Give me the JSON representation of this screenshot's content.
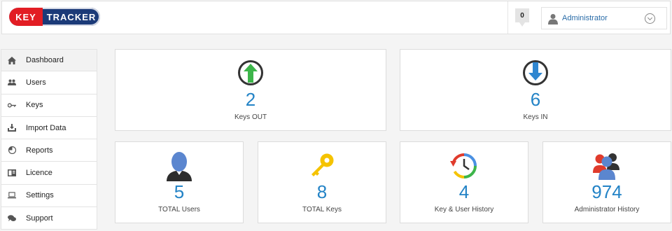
{
  "header": {
    "logo_left": "KEY",
    "logo_right": "TRACKER",
    "notification_count": "0",
    "user_name": "Administrator"
  },
  "sidebar": {
    "items": [
      {
        "label": "Dashboard",
        "icon": "home-icon",
        "active": true
      },
      {
        "label": "Users",
        "icon": "users-icon"
      },
      {
        "label": "Keys",
        "icon": "key-icon"
      },
      {
        "label": "Import Data",
        "icon": "import-icon"
      },
      {
        "label": "Reports",
        "icon": "pie-chart-icon"
      },
      {
        "label": "Licence",
        "icon": "licence-icon"
      },
      {
        "label": "Settings",
        "icon": "laptop-icon"
      },
      {
        "label": "Support",
        "icon": "chat-icon"
      }
    ]
  },
  "dashboard": {
    "keys_out": {
      "value": "2",
      "label": "Keys OUT",
      "icon": "arrow-up-circle-icon"
    },
    "keys_in": {
      "value": "6",
      "label": "Keys IN",
      "icon": "arrow-down-circle-icon"
    },
    "total_users": {
      "value": "5",
      "label": "TOTAL Users",
      "icon": "user-icon"
    },
    "total_keys": {
      "value": "8",
      "label": "TOTAL Keys",
      "icon": "key-icon"
    },
    "history": {
      "value": "4",
      "label": "Key & User History",
      "icon": "history-icon"
    },
    "admin_history": {
      "value": "974",
      "label": "Administrator History",
      "icon": "admin-group-icon"
    }
  },
  "colors": {
    "accent": "#2383c6",
    "logo_red": "#e21d24",
    "logo_blue": "#1b3a78"
  }
}
